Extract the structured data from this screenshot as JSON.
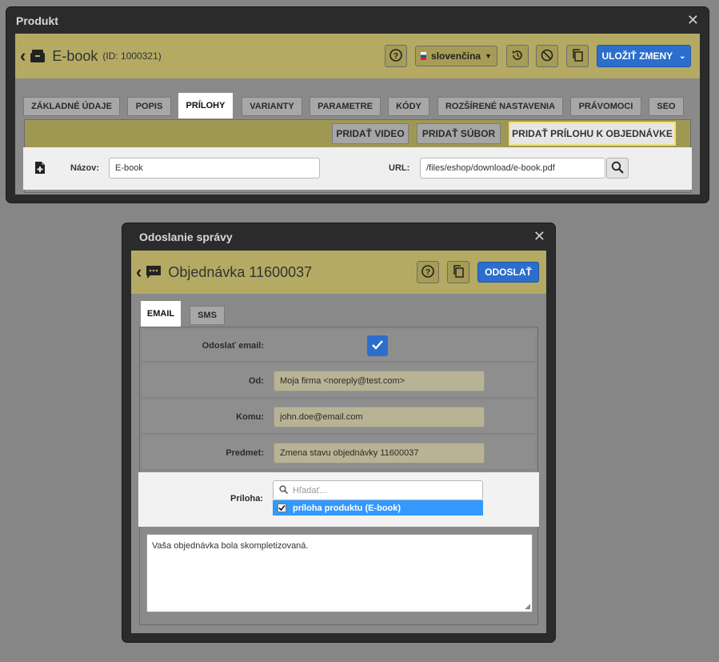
{
  "product_dialog": {
    "title": "Produkt",
    "header_title": "E-book",
    "header_id": "(ID: 1000321)",
    "language": "slovenčina",
    "save_label": "ULOŽIŤ ZMENY",
    "tabs": [
      "ZÁKLADNÉ ÚDAJE",
      "POPIS",
      "PRÍLOHY",
      "VARIANTY",
      "PARAMETRE",
      "KÓDY",
      "ROZŠÍRENÉ NASTAVENIA",
      "PRÁVOMOCI",
      "SEO"
    ],
    "active_tab": "PRÍLOHY",
    "actions": {
      "add_video": "PRIDAŤ VIDEO",
      "add_file": "PRIDAŤ SÚBOR",
      "add_order_attachment": "PRIDAŤ PRÍLOHU K OBJEDNÁVKE"
    },
    "attachment": {
      "name_label": "Názov:",
      "name_value": "E-book",
      "url_label": "URL:",
      "url_value": "/files/eshop/download/e-book.pdf"
    }
  },
  "message_dialog": {
    "title": "Odoslanie správy",
    "header_title": "Objednávka 11600037",
    "send_label": "ODOSLAŤ",
    "tabs": [
      "EMAIL",
      "SMS"
    ],
    "active_tab": "EMAIL",
    "fields": {
      "send_email_label": "Odoslať email:",
      "send_email_checked": true,
      "from_label": "Od:",
      "from_value": "Moja firma <noreply@test.com>",
      "to_label": "Komu:",
      "to_value": "john.doe@email.com",
      "subject_label": "Predmet:",
      "subject_value": "Zmena stavu objednávky  11600037",
      "attachment_label": "Príloha:",
      "attachment_search_placeholder": "Hľadať...",
      "attachment_option": "príloha produktu (E-book)",
      "attachment_option_checked": true
    },
    "body_text": "Vaša objednávka bola skompletizovaná."
  },
  "colors": {
    "accent_blue": "#2c6ecb",
    "header_olive": "#b4aa63",
    "selected_blue": "#3399ff"
  }
}
